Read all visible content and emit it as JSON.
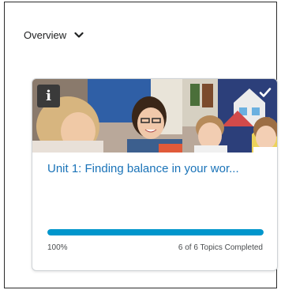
{
  "header": {
    "overview_label": "Overview",
    "toggle_icon": "chevron-down-icon"
  },
  "course_card": {
    "info_icon_glyph": "i",
    "info_icon": "info-icon",
    "complete_icon": "checkmark-icon",
    "title": "Unit 1: Finding balance in your wor...",
    "progress_fraction": 1.0,
    "progress_percent": "100%",
    "topics_completed": "6 of 6 Topics Completed"
  },
  "colors": {
    "link": "#1a73b8",
    "progress_fill": "#0096cc",
    "progress_track": "#e3e9f1",
    "info_badge": "#3a3a3a"
  }
}
